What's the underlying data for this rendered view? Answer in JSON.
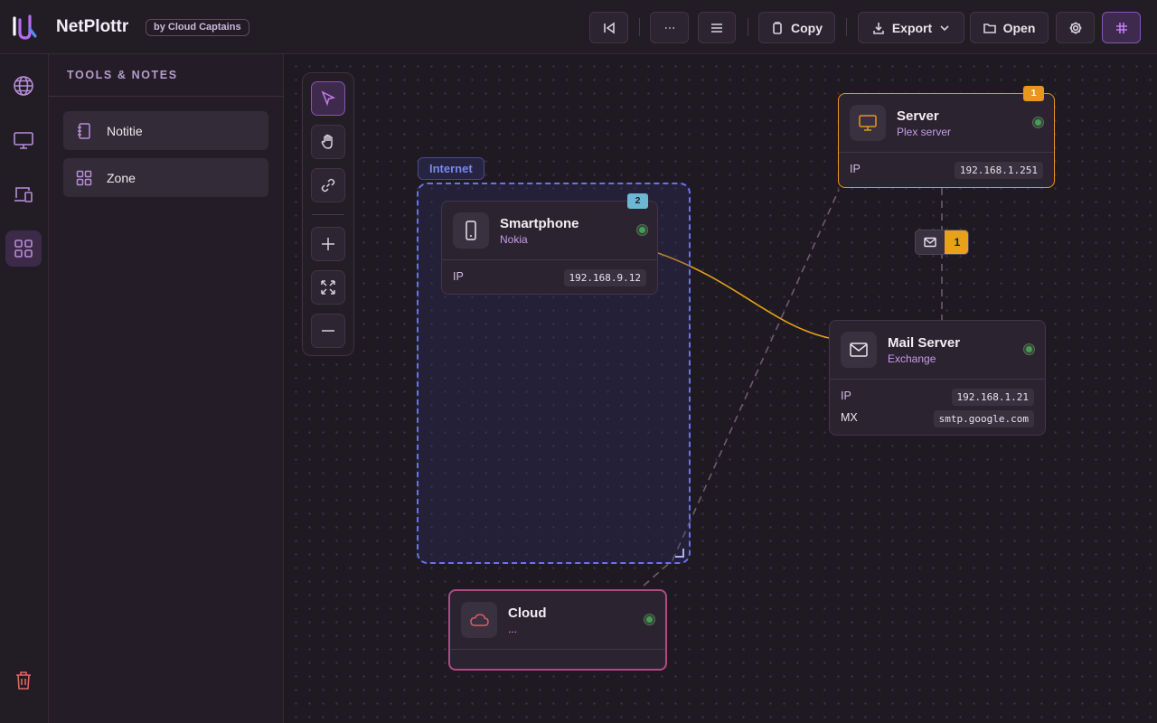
{
  "app": {
    "title": "NetPlottr",
    "by_badge": "by Cloud Captains"
  },
  "toolbar": {
    "back_icon": "skip-back-icon",
    "more_icon": "ellipsis-icon",
    "menu_icon": "hamburger-icon",
    "copy_label": "Copy",
    "export_label": "Export",
    "open_label": "Open",
    "settings_icon": "gear-icon",
    "grid_icon": "grid-icon"
  },
  "rail": {
    "items": [
      "globe-icon",
      "monitor-icon",
      "devices-icon",
      "apps-grid-icon"
    ],
    "active": "apps-grid-icon",
    "trash": "trash-icon"
  },
  "panel": {
    "title": "TOOLS & NOTES",
    "items": [
      {
        "label": "Notitie",
        "icon": "notebook-icon"
      },
      {
        "label": "Zone",
        "icon": "zone-grid-icon"
      }
    ]
  },
  "canvas_tools": [
    "pointer-icon",
    "hand-icon",
    "link-icon",
    "zoom-in-icon",
    "fit-icon",
    "zoom-out-icon"
  ],
  "zone": {
    "label": "Internet",
    "color": "#6a72f0"
  },
  "nodes": {
    "smartphone": {
      "title": "Smartphone",
      "subtitle": "Nokia",
      "badge": "2",
      "props": [
        {
          "key": "IP",
          "value": "192.168.9.12"
        }
      ]
    },
    "server": {
      "title": "Server",
      "subtitle": "Plex server",
      "badge": "1",
      "props": [
        {
          "key": "IP",
          "value": "192.168.1.251"
        }
      ]
    },
    "mail_server": {
      "title": "Mail Server",
      "subtitle": "Exchange",
      "props": [
        {
          "key": "IP",
          "value": "192.168.1.21"
        },
        {
          "key": "MX",
          "value": "smtp.google.com"
        }
      ]
    },
    "cloud": {
      "title": "Cloud",
      "subtitle": "..."
    }
  },
  "message_badge": {
    "count": "1"
  },
  "colors": {
    "accent": "#c27cf0",
    "server_border": "#e8961e",
    "cloud_border": "#b04a82",
    "link_active": "#e8a11a",
    "status_online": "#4a9a5a"
  }
}
